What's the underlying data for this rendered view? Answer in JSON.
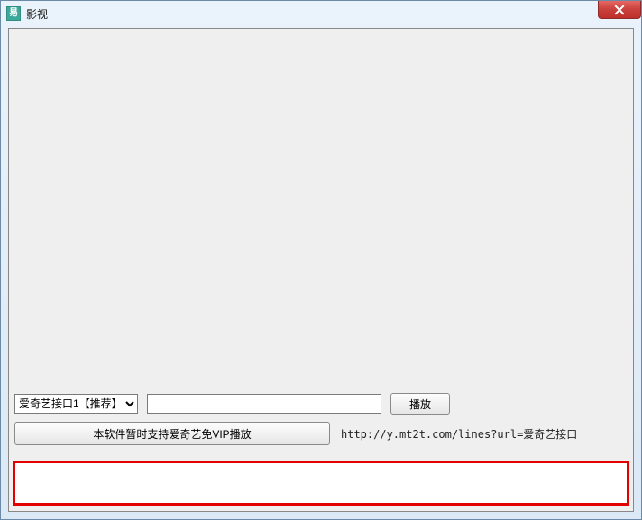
{
  "window": {
    "title": "影视",
    "icon_glyph": "易"
  },
  "controls": {
    "combo_selected": "爱奇艺接口1【推荐】",
    "url_value": "",
    "play_label": "播放"
  },
  "info": {
    "support_button_label": "本软件暂时支持爱奇艺免VIP播放",
    "status_text": "http://y.mt2t.com/lines?url=爱奇艺接口"
  }
}
